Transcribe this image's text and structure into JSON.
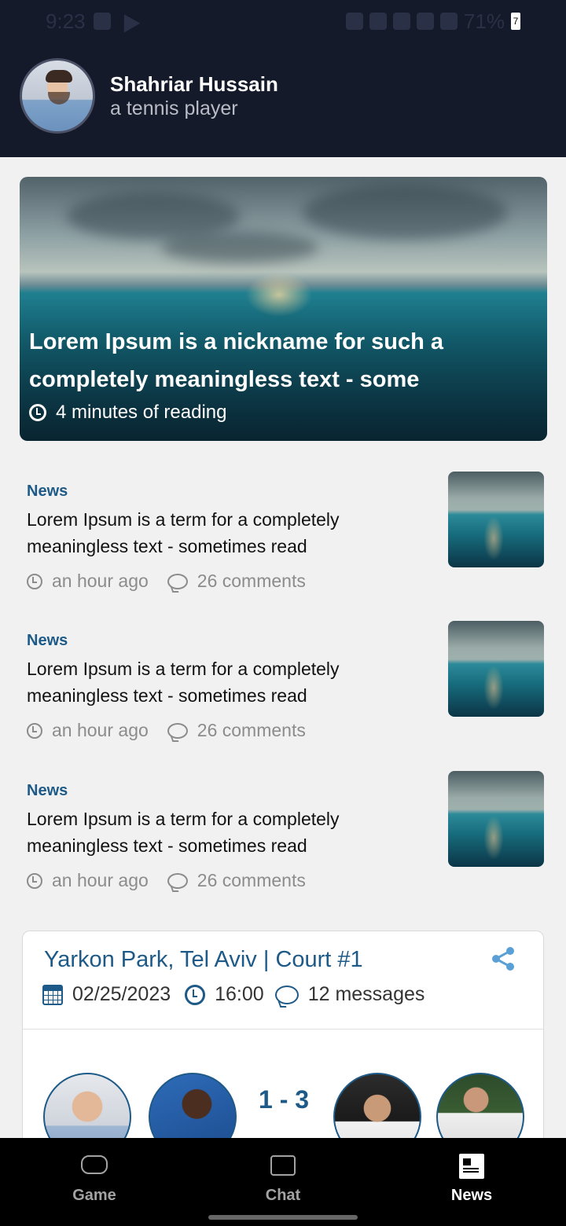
{
  "status_bar": {
    "time": "9:23",
    "battery": "71%",
    "battery_badge": "7"
  },
  "profile": {
    "name": "Shahriar Hussain",
    "role": "a tennis player"
  },
  "hero": {
    "title": "Lorem Ipsum is a nickname for such a completely meaningless text - some",
    "reading_time": "4 minutes of reading"
  },
  "news": [
    {
      "category": "News",
      "title": "Lorem Ipsum is a term for a completely meaningless text - sometimes read",
      "time": "an hour ago",
      "comments": "26 comments"
    },
    {
      "category": "News",
      "title": "Lorem Ipsum is a term for a completely meaningless text - sometimes read",
      "time": "an hour ago",
      "comments": "26 comments"
    },
    {
      "category": "News",
      "title": "Lorem Ipsum is a term for a completely meaningless text - sometimes read",
      "time": "an hour ago",
      "comments": "26 comments"
    }
  ],
  "match": {
    "venue": "Yarkon Park, Tel Aviv | Court #1",
    "date": "02/25/2023",
    "time": "16:00",
    "messages": "12 messages",
    "score": "1 - 3"
  },
  "nav": {
    "items": [
      {
        "label": "Game",
        "icon": "gamepad-icon",
        "active": false
      },
      {
        "label": "Chat",
        "icon": "chat-bubble-icon",
        "active": false
      },
      {
        "label": "News",
        "icon": "newspaper-icon",
        "active": true
      }
    ]
  },
  "colors": {
    "header_bg": "#151a2a",
    "accent": "#1e5a87",
    "page_bg": "#f1f1f2",
    "nav_bg": "#000000"
  }
}
